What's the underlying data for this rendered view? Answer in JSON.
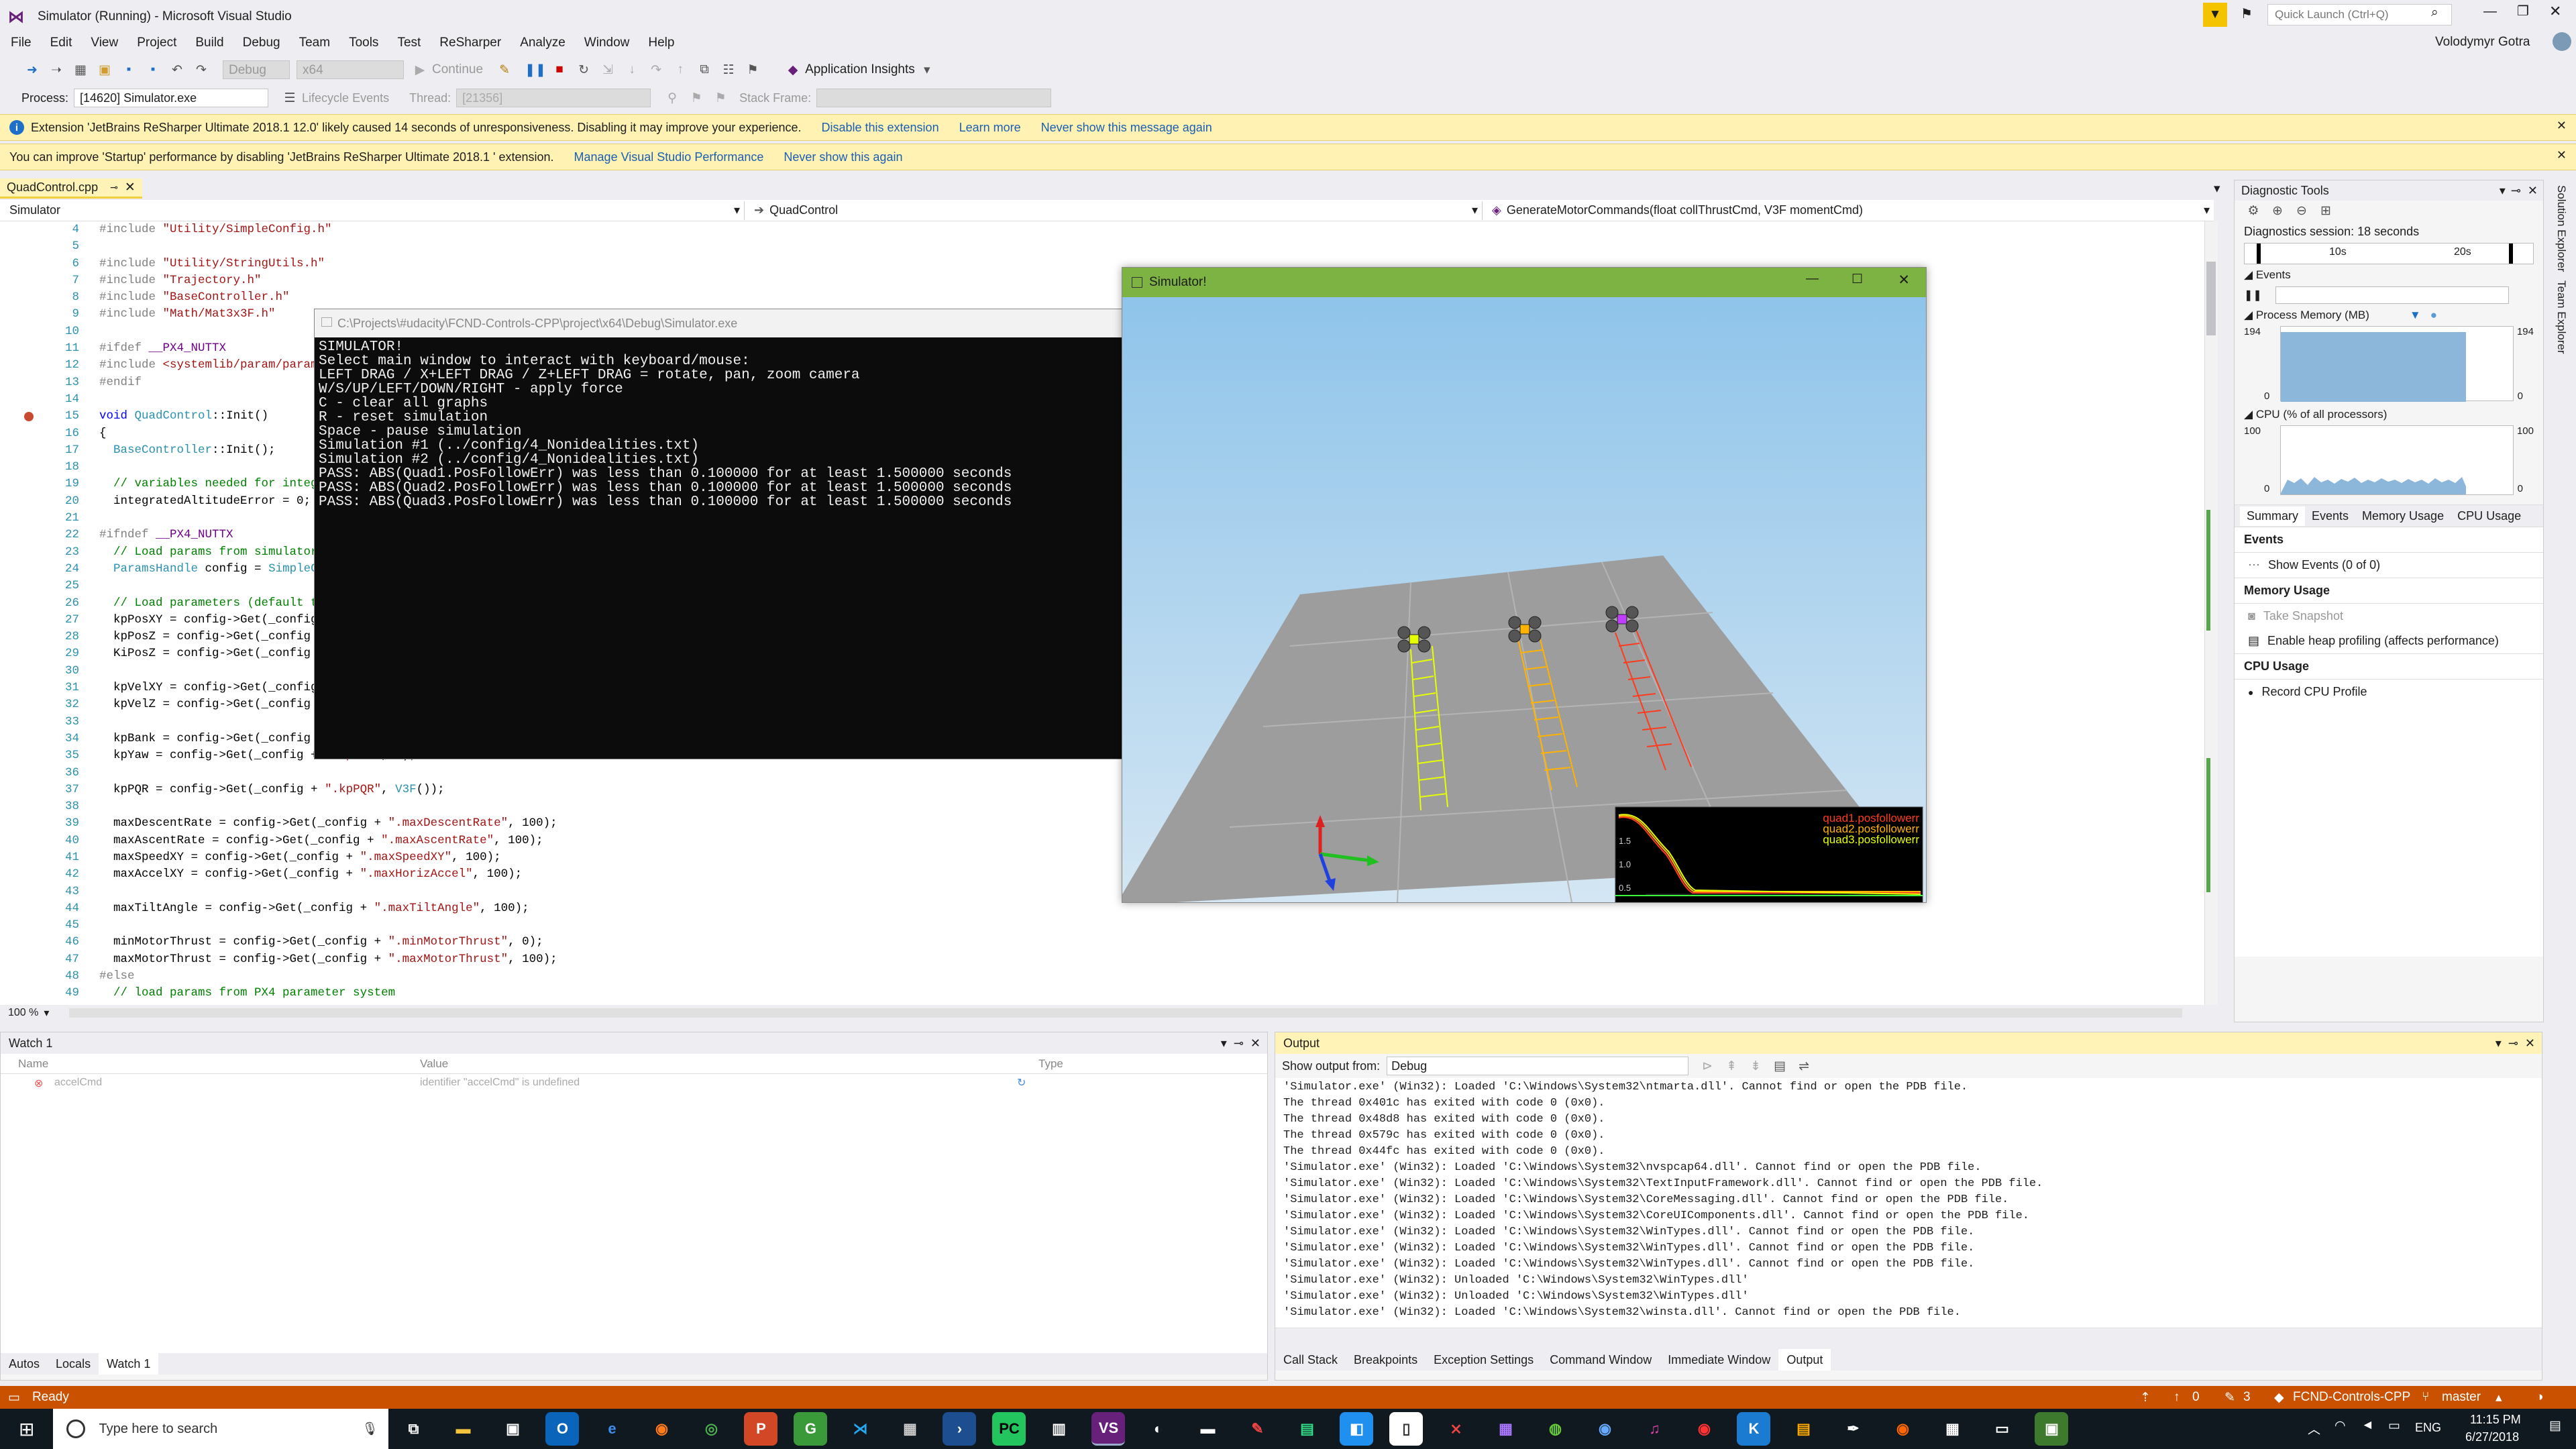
{
  "window": {
    "title": "Simulator (Running) - Microsoft Visual Studio",
    "quick_launch_placeholder": "Quick Launch (Ctrl+Q)",
    "user": "Volodymyr Gotra"
  },
  "menu": [
    "File",
    "Edit",
    "View",
    "Project",
    "Build",
    "Debug",
    "Team",
    "Tools",
    "Test",
    "ReSharper",
    "Analyze",
    "Window",
    "Help"
  ],
  "toolbar": {
    "config": "Debug",
    "platform": "x64",
    "continue_label": "Continue",
    "app_insights": "Application Insights",
    "process_label": "Process:",
    "process_value": "[14620] Simulator.exe",
    "lifecycle": "Lifecycle Events",
    "thread_label": "Thread:",
    "thread_value": "[21356]",
    "stack_label": "Stack Frame:"
  },
  "infobar1": {
    "text": "Extension 'JetBrains ReSharper Ultimate 2018.1  12.0' likely caused 14 seconds of unresponsiveness. Disabling it may improve your experience.",
    "links": [
      "Disable this extension",
      "Learn more",
      "Never show this message again"
    ]
  },
  "infobar2": {
    "text": "You can improve 'Startup' performance by disabling 'JetBrains ReSharper Ultimate 2018.1 ' extension.",
    "links": [
      "Manage Visual Studio Performance",
      "Never show this again"
    ]
  },
  "editor": {
    "tab": "QuadControl.cpp",
    "nav": [
      "Simulator",
      "QuadControl",
      "GenerateMotorCommands(float collThrustCmd, V3F momentCmd)"
    ],
    "zoom": "100 %",
    "gutter": [
      "4",
      "5",
      "6",
      "7",
      "8",
      "9",
      "10",
      "11",
      "12",
      "13",
      "14",
      "15",
      "16",
      "17",
      "18",
      "19",
      "20",
      "21",
      "22",
      "23",
      "24",
      "25",
      "26",
      "27",
      "28",
      "29",
      "30",
      "31",
      "32",
      "33",
      "34",
      "35",
      "36",
      "37",
      "38",
      "39",
      "40",
      "41",
      "42",
      "43",
      "44",
      "45",
      "46",
      "47",
      "48",
      "49"
    ],
    "lines": [
      "#include \"Utility/SimpleConfig.h\"",
      "",
      "#include \"Utility/StringUtils.h\"",
      "#include \"Trajectory.h\"",
      "#include \"BaseController.h\"",
      "#include \"Math/Mat3x3F.h\"",
      "",
      "#ifdef __PX4_NUTTX",
      "#include <systemlib/param/param.h>",
      "#endif",
      "",
      "void QuadControl::Init()",
      "{",
      "  BaseController::Init();",
      "",
      "  // variables needed for integral control",
      "  integratedAltitudeError = 0;",
      "",
      "#ifndef __PX4_NUTTX",
      "  // Load params from simulator parameter system",
      "  ParamsHandle config = SimpleConfig::GetInstance();",
      "",
      "  // Load parameters (default to 0)",
      "  kpPosXY = config->Get(_config + \".kpPosXY\", 0);",
      "  kpPosZ = config->Get(_config + \".kpPosZ\", 0);",
      "  KiPosZ = config->Get(_config + \".KiPosZ\", 0);",
      "",
      "  kpVelXY = config->Get(_config + \".kpVelXY\", 0);",
      "  kpVelZ = config->Get(_config + \".kpVelZ\", 0);",
      "",
      "  kpBank = config->Get(_config + \".kpBank\", 0);",
      "  kpYaw = config->Get(_config + \".kpYaw\", 0);",
      "",
      "  kpPQR = config->Get(_config + \".kpPQR\", V3F());",
      "",
      "  maxDescentRate = config->Get(_config + \".maxDescentRate\", 100);",
      "  maxAscentRate = config->Get(_config + \".maxAscentRate\", 100);",
      "  maxSpeedXY = config->Get(_config + \".maxSpeedXY\", 100);",
      "  maxAccelXY = config->Get(_config + \".maxHorizAccel\", 100);",
      "",
      "  maxTiltAngle = config->Get(_config + \".maxTiltAngle\", 100);",
      "",
      "  minMotorThrust = config->Get(_config + \".minMotorThrust\", 0);",
      "  maxMotorThrust = config->Get(_config + \".maxMotorThrust\", 100);",
      "#else",
      "  // load params from PX4 parameter system"
    ]
  },
  "console": {
    "title": "C:\\Projects\\#udacity\\FCND-Controls-CPP\\project\\x64\\Debug\\Simulator.exe",
    "lines": [
      "SIMULATOR!",
      "Select main window to interact with keyboard/mouse:",
      "LEFT DRAG / X+LEFT DRAG / Z+LEFT DRAG = rotate, pan, zoom camera",
      "W/S/UP/LEFT/DOWN/RIGHT - apply force",
      "C - clear all graphs",
      "R - reset simulation",
      "Space - pause simulation",
      "Simulation #1 (../config/4_Nonidealities.txt)",
      "Simulation #2 (../config/4_Nonidealities.txt)",
      "PASS: ABS(Quad1.PosFollowErr) was less than 0.100000 for at least 1.500000 seconds",
      "PASS: ABS(Quad2.PosFollowErr) was less than 0.100000 for at least 1.500000 seconds",
      "PASS: ABS(Quad3.PosFollowErr) was less than 0.100000 for at least 1.500000 seconds"
    ]
  },
  "simulator": {
    "title": "Simulator!",
    "legend": [
      "quad1.posfollowerr",
      "quad2.posfollowerr",
      "quad3.posfollowerr"
    ],
    "legend_colors": [
      "#ff3b1f",
      "#ffb300",
      "#e6ff00"
    ],
    "ticks": [
      "1.5",
      "1.0",
      "0.5"
    ]
  },
  "diag": {
    "title": "Diagnostic Tools",
    "session": "Diagnostics session: 18 seconds",
    "timeline": [
      "10s",
      "20s"
    ],
    "events_label": "Events",
    "mem_label": "Process Memory (MB)",
    "mem_max": "194",
    "mem_min": "0",
    "cpu_label": "CPU (% of all processors)",
    "cpu_max": "100",
    "cpu_min": "0",
    "tabs": [
      "Summary",
      "Events",
      "Memory Usage",
      "CPU Usage"
    ],
    "sec_events": "Events",
    "show_events": "Show Events (0 of 0)",
    "sec_mem": "Memory Usage",
    "take_snapshot": "Take Snapshot",
    "heap": "Enable heap profiling (affects performance)",
    "sec_cpu": "CPU Usage",
    "record_cpu": "Record CPU Profile",
    "side": [
      "Solution Explorer",
      "Team Explorer"
    ]
  },
  "watch": {
    "title": "Watch 1",
    "cols": [
      "Name",
      "Value",
      "Type"
    ],
    "row": {
      "name": "accelCmd",
      "value": "identifier \"accelCmd\" is undefined"
    },
    "tabs": [
      "Autos",
      "Locals",
      "Watch 1"
    ]
  },
  "output": {
    "title": "Output",
    "show_from_label": "Show output from:",
    "show_from_value": "Debug",
    "lines": [
      "'Simulator.exe' (Win32): Loaded 'C:\\Windows\\System32\\ntmarta.dll'. Cannot find or open the PDB file.",
      "The thread 0x401c has exited with code 0 (0x0).",
      "The thread 0x48d8 has exited with code 0 (0x0).",
      "The thread 0x579c has exited with code 0 (0x0).",
      "The thread 0x44fc has exited with code 0 (0x0).",
      "'Simulator.exe' (Win32): Loaded 'C:\\Windows\\System32\\nvspcap64.dll'. Cannot find or open the PDB file.",
      "'Simulator.exe' (Win32): Loaded 'C:\\Windows\\System32\\TextInputFramework.dll'. Cannot find or open the PDB file.",
      "'Simulator.exe' (Win32): Loaded 'C:\\Windows\\System32\\CoreMessaging.dll'. Cannot find or open the PDB file.",
      "'Simulator.exe' (Win32): Loaded 'C:\\Windows\\System32\\CoreUIComponents.dll'. Cannot find or open the PDB file.",
      "'Simulator.exe' (Win32): Loaded 'C:\\Windows\\System32\\WinTypes.dll'. Cannot find or open the PDB file.",
      "'Simulator.exe' (Win32): Loaded 'C:\\Windows\\System32\\WinTypes.dll'. Cannot find or open the PDB file.",
      "'Simulator.exe' (Win32): Loaded 'C:\\Windows\\System32\\WinTypes.dll'. Cannot find or open the PDB file.",
      "'Simulator.exe' (Win32): Unloaded 'C:\\Windows\\System32\\WinTypes.dll'",
      "'Simulator.exe' (Win32): Unloaded 'C:\\Windows\\System32\\WinTypes.dll'",
      "'Simulator.exe' (Win32): Loaded 'C:\\Windows\\System32\\winsta.dll'. Cannot find or open the PDB file."
    ],
    "tabs": [
      "Call Stack",
      "Breakpoints",
      "Exception Settings",
      "Command Window",
      "Immediate Window",
      "Output"
    ]
  },
  "status": {
    "ready": "Ready",
    "up": "0",
    "pencil": "3",
    "repo": "FCND-Controls-CPP",
    "branch": "master"
  },
  "taskbar": {
    "search": "Type here to search",
    "time": "11:15 PM",
    "date": "6/27/2018",
    "lang": "ENG"
  }
}
